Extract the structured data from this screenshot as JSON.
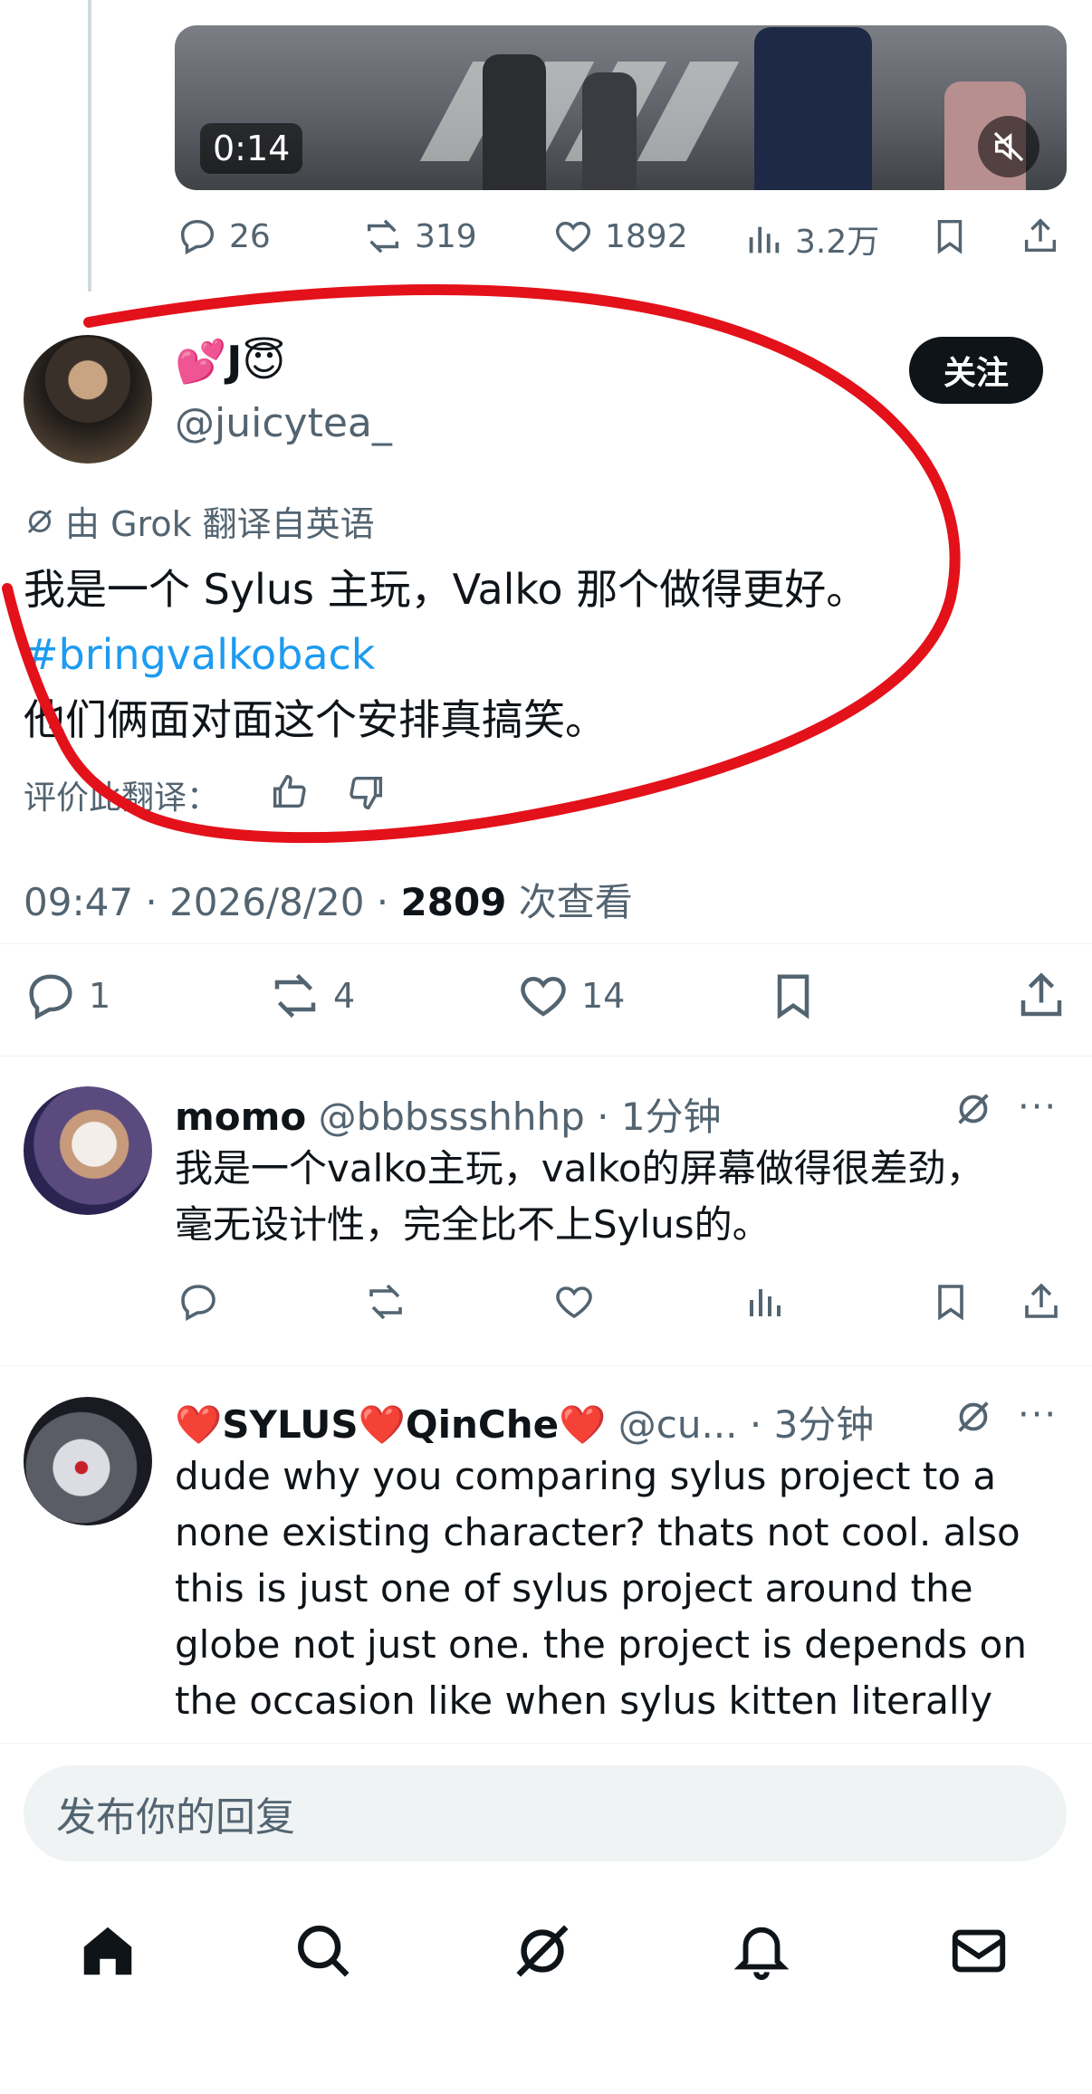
{
  "video": {
    "time": "0:14"
  },
  "top_post_stats": {
    "replies": "26",
    "reposts": "319",
    "likes": "1892",
    "views": "3.2万"
  },
  "main_post": {
    "display_name": "💕J😇",
    "handle": "@juicytea_",
    "follow_label": "关注",
    "translated_from": "由 Grok 翻译自英语",
    "text_line1": "我是一个 Sylus 主玩，Valko 那个做得更好。",
    "hashtag": "#bringvalkoback",
    "text_line2": "他们俩面对面这个安排真搞笑。",
    "rate_label": "评价此翻译：",
    "meta_time": "09:47 · 2026/8/20 · ",
    "meta_views_count": "2809",
    "meta_views_label": " 次查看",
    "stats": {
      "replies": "1",
      "reposts": "4",
      "likes": "14"
    }
  },
  "replies": [
    {
      "display_name": "momo",
      "handle": "@bbbssshhhp",
      "time": "· 1分钟",
      "text": "我是一个valko主玩，valko的屏幕做得很差劲，毫无设计性，完全比不上Sylus的。"
    },
    {
      "display_name": "❤️SYLUS❤️QinChe❤️",
      "handle": "@cu...",
      "time": "· 3分钟",
      "text": "dude why you comparing sylus project to a none existing character? thats not cool. also this is just one of sylus project around the globe not just one. the project is depends on the occasion like when sylus kitten literally lights up buildings for a day"
    }
  ],
  "reply_input": {
    "placeholder": "发布你的回复"
  },
  "colors": {
    "accent": "#1d9bf0",
    "text": "#0f1419",
    "muted": "#536471",
    "annotation": "#e3111a"
  },
  "nav": [
    "home-icon",
    "search-icon",
    "grok-icon",
    "notifications-icon",
    "messages-icon"
  ]
}
